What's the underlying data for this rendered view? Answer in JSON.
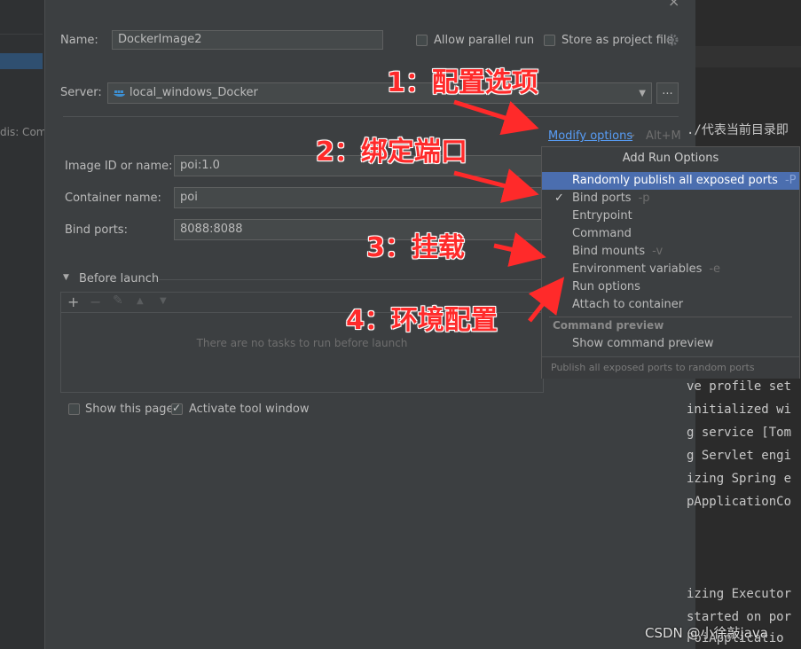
{
  "left_panel": {
    "text": "dis: Comp"
  },
  "dialog": {
    "close_glyph": "×",
    "name_label": "Name:",
    "name_value": "DockerImage2",
    "allow_parallel_label": "Allow parallel run",
    "store_label": "Store as project file",
    "server_label": "Server:",
    "server_value": "local_windows_Docker",
    "browse_label": "...",
    "modify_options_label": "Modify options",
    "modify_shortcut": "Alt+M",
    "image_label": "Image ID or name:",
    "image_value": "poi:1.0",
    "container_label": "Container name:",
    "container_value": "poi",
    "bind_ports_label": "Bind ports:",
    "bind_ports_value": "8088:8088",
    "before_launch_label": "Before launch",
    "empty_tasks": "There are no tasks to run before launch",
    "show_page_label": "Show this page",
    "activate_tool_label": "Activate tool window",
    "toolbar": {
      "add": "+",
      "remove": "−",
      "edit": "✎",
      "up": "▲",
      "down": "▼"
    }
  },
  "popup": {
    "title": "Add Run Options",
    "items": [
      {
        "label": "Randomly publish all exposed ports",
        "hotkey": "-P",
        "selected": true,
        "checked": false
      },
      {
        "label": "Bind ports",
        "hotkey": "-p",
        "selected": false,
        "checked": true
      },
      {
        "label": "Entrypoint",
        "hotkey": "",
        "selected": false,
        "checked": false
      },
      {
        "label": "Command",
        "hotkey": "",
        "selected": false,
        "checked": false
      },
      {
        "label": "Bind mounts",
        "hotkey": "-v",
        "selected": false,
        "checked": false
      },
      {
        "label": "Environment variables",
        "hotkey": "-e",
        "selected": false,
        "checked": false
      },
      {
        "label": "Run options",
        "hotkey": "",
        "selected": false,
        "checked": false
      },
      {
        "label": "Attach to container",
        "hotkey": "",
        "selected": false,
        "checked": false
      }
    ],
    "section_title": "Command preview",
    "section_item": "Show command preview",
    "footer": "Publish all exposed ports to random ports"
  },
  "annotations": [
    {
      "text": "1：配置选项"
    },
    {
      "text": "2：绑定端口"
    },
    {
      "text": "3：挂载"
    },
    {
      "text": "4：环境配置"
    }
  ],
  "editor": {
    "lines": [
      "./代表当前目录即",
      "ve profile set",
      "initialized wi",
      "g service [Tom",
      "g Servlet engi",
      "izing Spring e",
      "pApplicationCo",
      "izing Executor",
      "started on por",
      "PoiApplicatio"
    ]
  },
  "watermark": "CSDN @小徐敲java",
  "colors": {
    "accent": "#4b6eaf",
    "link": "#589df6",
    "annotation": "#ff2a2a"
  }
}
